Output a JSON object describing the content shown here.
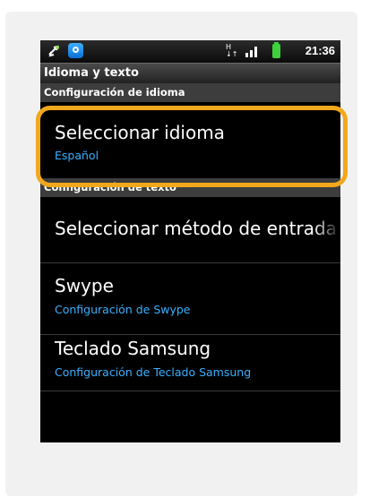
{
  "statusbar": {
    "network_label": "H",
    "network_sub": "↓↑",
    "time": "21:36",
    "icons": [
      "usb-icon",
      "app-notification-icon",
      "signal-icon",
      "battery-icon"
    ]
  },
  "titlebar": {
    "title": "Idioma y texto"
  },
  "sections": {
    "language": "Configuración de idioma",
    "text": "Configuración de texto"
  },
  "items": [
    {
      "title": "Seleccionar idioma",
      "subtitle": "Español"
    },
    {
      "title": "Seleccionar método de entrada",
      "subtitle": ""
    },
    {
      "title": "Swype",
      "subtitle": "Configuración de Swype"
    },
    {
      "title": "Teclado Samsung",
      "subtitle": "Configuración de Teclado Samsung"
    }
  ],
  "colors": {
    "highlight": "#f2a81d",
    "subtitle": "#3ab0ff",
    "background": "#000000"
  }
}
